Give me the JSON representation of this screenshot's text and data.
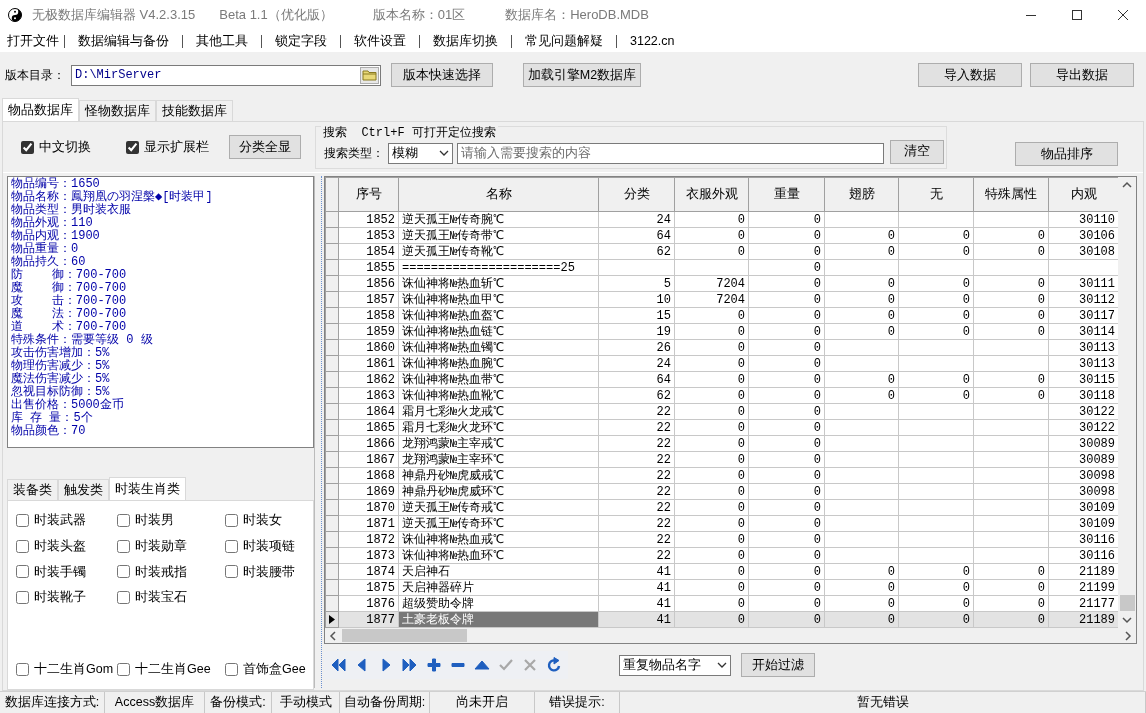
{
  "window": {
    "title_parts": [
      "无极数据库编辑器 V4.2.3.15",
      "Beta 1.1（优化版）",
      "版本名称：01区",
      "数据库名：HeroDB.MDB"
    ]
  },
  "menu": [
    "打开文件",
    "数据编辑与备份",
    "其他工具",
    "锁定字段",
    "软件设置",
    "数据库切换",
    "常见问题解疑",
    "3122.cn"
  ],
  "version_dir": {
    "label": "版本目录：",
    "value": "D:\\MirServer"
  },
  "toolbar_buttons": [
    "版本快速选择",
    "加载引擎M2数据库"
  ],
  "data_buttons": [
    "导入数据",
    "导出数据"
  ],
  "tabs": [
    {
      "label": "物品数据库",
      "selected": true
    },
    {
      "label": "怪物数据库",
      "selected": false
    },
    {
      "label": "技能数据库",
      "selected": false
    }
  ],
  "options": [
    {
      "label": "中文切换",
      "checked": true
    },
    {
      "label": "显示扩展栏",
      "checked": true
    }
  ],
  "show_all_button": "分类全显",
  "search": {
    "legend": "搜索  Ctrl+F 可打开定位搜索",
    "type_label": "搜索类型：",
    "type_value": "模糊",
    "placeholder": "请输入需要搜索的内容",
    "clear_button": "清空"
  },
  "sort_button": "物品排序",
  "item_info": [
    "物品编号：1650",
    "物品名称：鳳翔凰の羽涅槃◆[时装甲]",
    "物品类型：男时装衣服",
    "物品外观：110",
    "物品内观：1900",
    "物品重量：0",
    "物品持久：60",
    "防    御：700-700",
    "魔    御：700-700",
    "攻    击：700-700",
    "魔    法：700-700",
    "道    术：700-700",
    "特殊条件：需要等级 0 级",
    "攻击伤害增加：5%",
    "物理伤害减少：5%",
    "魔法伤害减少：5%",
    "忽视目标防御：5%",
    "出售价格：5000金币",
    "库 存 量：5个",
    "物品颜色：70"
  ],
  "category_tabs": [
    {
      "label": "装备类",
      "selected": false
    },
    {
      "label": "触发类",
      "selected": false
    },
    {
      "label": "时装生肖类",
      "selected": true
    }
  ],
  "category_checkboxes": [
    {
      "label": "时装武器",
      "checked": false
    },
    {
      "label": "时装男",
      "checked": false
    },
    {
      "label": "时装女",
      "checked": false
    },
    {
      "label": "时装头盔",
      "checked": false
    },
    {
      "label": "时装勋章",
      "checked": false
    },
    {
      "label": "时装项链",
      "checked": false
    },
    {
      "label": "时装手镯",
      "checked": false
    },
    {
      "label": "时装戒指",
      "checked": false
    },
    {
      "label": "时装腰带",
      "checked": false
    },
    {
      "label": "时装靴子",
      "checked": false
    },
    {
      "label": "时装宝石",
      "checked": false
    }
  ],
  "extra_checkboxes": [
    {
      "label": "十二生肖Gom",
      "checked": false
    },
    {
      "label": "十二生肖Gee",
      "checked": false
    },
    {
      "label": "首饰盒Gee",
      "checked": false
    }
  ],
  "table": {
    "columns": [
      "序号",
      "名称",
      "分类",
      "衣服外观",
      "重量",
      "翅膀",
      "无",
      "特殊属性",
      "内观"
    ],
    "rows": [
      {
        "cells": [
          "1852",
          "逆天孤王№传奇腕℃",
          "24",
          "0",
          "0",
          null,
          null,
          null,
          "30110"
        ],
        "selected": false
      },
      {
        "cells": [
          "1853",
          "逆天孤王№传奇带℃",
          "64",
          "0",
          "0",
          "0",
          "0",
          "0",
          "30106"
        ],
        "selected": false
      },
      {
        "cells": [
          "1854",
          "逆天孤王№传奇靴℃",
          "62",
          "0",
          "0",
          "0",
          "0",
          "0",
          "30108"
        ],
        "selected": false
      },
      {
        "cells": [
          "1855",
          "======================25",
          null,
          null,
          "0",
          null,
          null,
          null,
          null
        ],
        "selected": false
      },
      {
        "cells": [
          "1856",
          "诛仙神将№热血斩℃",
          "5",
          "7204",
          "0",
          "0",
          "0",
          "0",
          "30111"
        ],
        "selected": false
      },
      {
        "cells": [
          "1857",
          "诛仙神将№热血甲℃",
          "10",
          "7204",
          "0",
          "0",
          "0",
          "0",
          "30112"
        ],
        "selected": false
      },
      {
        "cells": [
          "1858",
          "诛仙神将№热血盔℃",
          "15",
          "0",
          "0",
          "0",
          "0",
          "0",
          "30117"
        ],
        "selected": false
      },
      {
        "cells": [
          "1859",
          "诛仙神将№热血链℃",
          "19",
          "0",
          "0",
          "0",
          "0",
          "0",
          "30114"
        ],
        "selected": false
      },
      {
        "cells": [
          "1860",
          "诛仙神将№热血镯℃",
          "26",
          "0",
          "0",
          null,
          null,
          null,
          "30113"
        ],
        "selected": false
      },
      {
        "cells": [
          "1861",
          "诛仙神将№热血腕℃",
          "24",
          "0",
          "0",
          null,
          null,
          null,
          "30113"
        ],
        "selected": false
      },
      {
        "cells": [
          "1862",
          "诛仙神将№热血带℃",
          "64",
          "0",
          "0",
          "0",
          "0",
          "0",
          "30115"
        ],
        "selected": false
      },
      {
        "cells": [
          "1863",
          "诛仙神将№热血靴℃",
          "62",
          "0",
          "0",
          "0",
          "0",
          "0",
          "30118"
        ],
        "selected": false
      },
      {
        "cells": [
          "1864",
          "霜月七彩№火龙戒℃",
          "22",
          "0",
          "0",
          null,
          null,
          null,
          "30122"
        ],
        "selected": false
      },
      {
        "cells": [
          "1865",
          "霜月七彩№火龙环℃",
          "22",
          "0",
          "0",
          null,
          null,
          null,
          "30122"
        ],
        "selected": false
      },
      {
        "cells": [
          "1866",
          "龙翔鸿蒙№主宰戒℃",
          "22",
          "0",
          "0",
          null,
          null,
          null,
          "30089"
        ],
        "selected": false
      },
      {
        "cells": [
          "1867",
          "龙翔鸿蒙№主宰环℃",
          "22",
          "0",
          "0",
          null,
          null,
          null,
          "30089"
        ],
        "selected": false
      },
      {
        "cells": [
          "1868",
          "神鼎丹砂№虎威戒℃",
          "22",
          "0",
          "0",
          null,
          null,
          null,
          "30098"
        ],
        "selected": false
      },
      {
        "cells": [
          "1869",
          "神鼎丹砂№虎威环℃",
          "22",
          "0",
          "0",
          null,
          null,
          null,
          "30098"
        ],
        "selected": false
      },
      {
        "cells": [
          "1870",
          "逆天孤王№传奇戒℃",
          "22",
          "0",
          "0",
          null,
          null,
          null,
          "30109"
        ],
        "selected": false
      },
      {
        "cells": [
          "1871",
          "逆天孤王№传奇环℃",
          "22",
          "0",
          "0",
          null,
          null,
          null,
          "30109"
        ],
        "selected": false
      },
      {
        "cells": [
          "1872",
          "诛仙神将№热血戒℃",
          "22",
          "0",
          "0",
          null,
          null,
          null,
          "30116"
        ],
        "selected": false
      },
      {
        "cells": [
          "1873",
          "诛仙神将№热血环℃",
          "22",
          "0",
          "0",
          null,
          null,
          null,
          "30116"
        ],
        "selected": false
      },
      {
        "cells": [
          "1874",
          "天启神石",
          "41",
          "0",
          "0",
          "0",
          "0",
          "0",
          "21189"
        ],
        "selected": false
      },
      {
        "cells": [
          "1875",
          "天启神器碎片",
          "41",
          "0",
          "0",
          "0",
          "0",
          "0",
          "21199"
        ],
        "selected": false
      },
      {
        "cells": [
          "1876",
          "超级赞助令牌",
          "41",
          "0",
          "0",
          "0",
          "0",
          "0",
          "21177"
        ],
        "selected": false
      },
      {
        "cells": [
          "1877",
          "土豪老板令牌",
          "41",
          "0",
          "0",
          "0",
          "0",
          "0",
          "21189"
        ],
        "selected": true
      }
    ]
  },
  "navigator": [
    {
      "kind": "first",
      "disabled": false
    },
    {
      "kind": "prior",
      "disabled": false
    },
    {
      "kind": "next",
      "disabled": false
    },
    {
      "kind": "last",
      "disabled": false
    },
    {
      "kind": "insert",
      "disabled": false
    },
    {
      "kind": "delete",
      "disabled": false
    },
    {
      "kind": "edit",
      "disabled": false
    },
    {
      "kind": "post",
      "disabled": true
    },
    {
      "kind": "cancel",
      "disabled": true
    },
    {
      "kind": "refresh",
      "disabled": false
    }
  ],
  "filter": {
    "value": "重复物品名字",
    "button": "开始过滤"
  },
  "status_bar": [
    "数据库连接方式:",
    "Access数据库",
    "备份模式:",
    "手动模式",
    "自动备份周期:",
    "尚未开启",
    "错误提示:",
    "暂无错误"
  ]
}
